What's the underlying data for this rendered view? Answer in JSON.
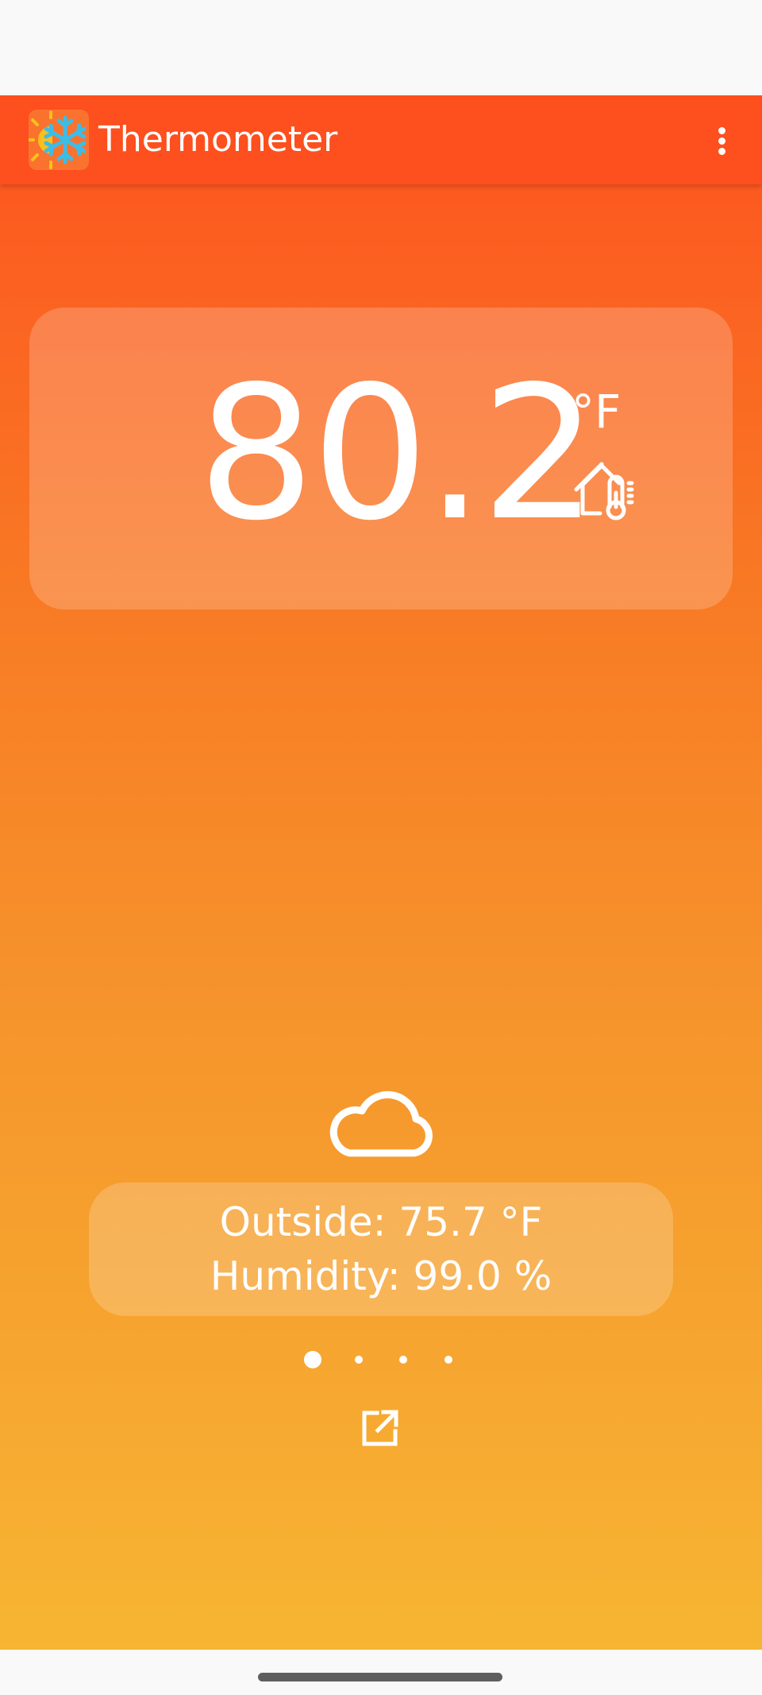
{
  "app_bar": {
    "title": "Thermometer",
    "logo_icon": "sun-snowflake-logo-icon",
    "menu_icon": "more-vert-icon",
    "color": "#fe4f1e"
  },
  "indoor": {
    "temperature": "80.2",
    "unit": "°F",
    "icon": "home-thermometer-icon"
  },
  "outdoor": {
    "condition_icon": "cloud-icon",
    "outside_text": "Outside: 75.7 °F",
    "humidity_text": "Humidity: 99.0 %"
  },
  "pager": {
    "pages": 4,
    "current_page": 1
  },
  "actions": {
    "open_icon": "open-in-new-icon"
  },
  "colors": {
    "gradient_top": "#fd531f",
    "gradient_bottom": "#f7b533",
    "text": "#ffffff"
  }
}
